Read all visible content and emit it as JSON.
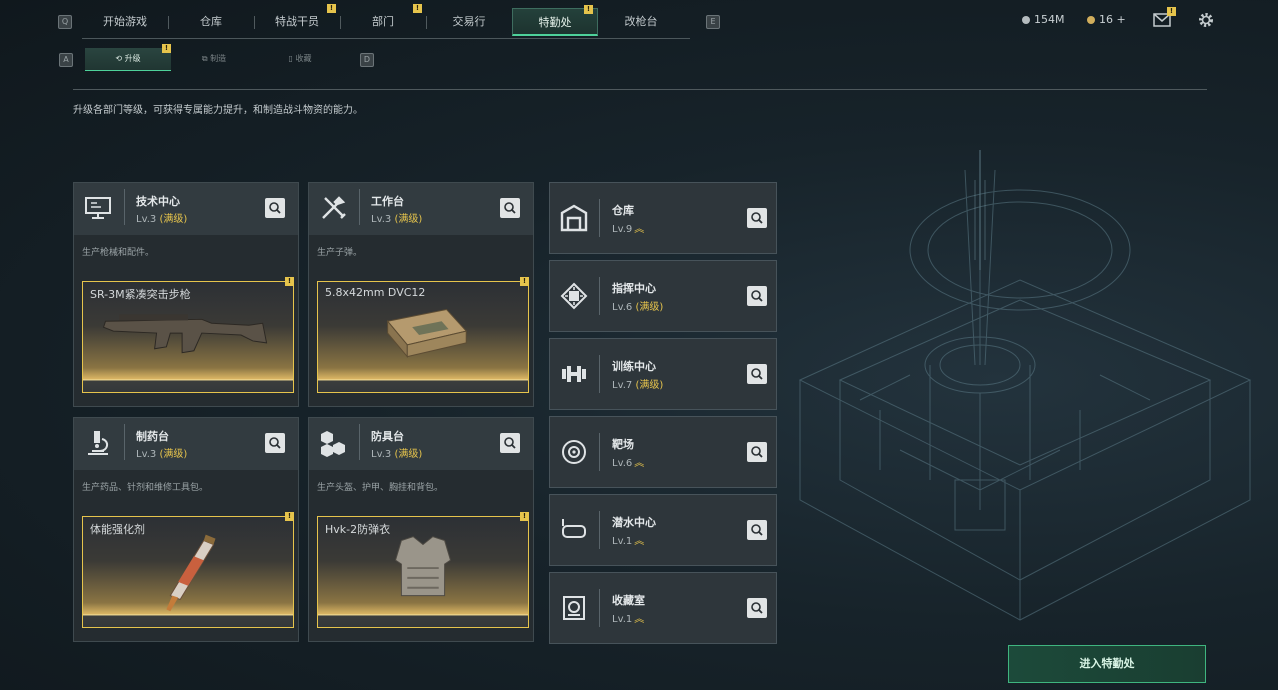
{
  "nav": {
    "left_key": "Q",
    "right_key": "E",
    "tabs": [
      {
        "label": "开始游戏",
        "badge": ""
      },
      {
        "label": "仓库",
        "badge": ""
      },
      {
        "label": "特战干员",
        "badge": "!"
      },
      {
        "label": "部门",
        "badge": "!"
      },
      {
        "label": "交易行",
        "badge": ""
      },
      {
        "label": "特勤处",
        "badge": "!",
        "active": true
      },
      {
        "label": "改枪台",
        "badge": ""
      }
    ]
  },
  "resources": {
    "currency": "154M",
    "coins": "16 +",
    "mail_badge": "!"
  },
  "subtabs": {
    "left_key": "A",
    "right_key": "D",
    "items": [
      {
        "label": "升级",
        "badge": "!",
        "active": true
      },
      {
        "label": "制造"
      },
      {
        "label": "收藏"
      }
    ]
  },
  "description": "升级各部门等级，可获得专属能力提升，和制造战斗物资的能力。",
  "cards": [
    {
      "name": "技术中心",
      "level": "Lv.3",
      "max": "(满级)",
      "text": "生产枪械和配件。",
      "item": "SR-3M紧凑突击步枪",
      "icon": "computer-icon",
      "badge": "!"
    },
    {
      "name": "工作台",
      "level": "Lv.3",
      "max": "(满级)",
      "text": "生产子弹。",
      "item": "5.8x42mm DVC12",
      "icon": "tools-icon",
      "badge": "!"
    },
    {
      "name": "制药台",
      "level": "Lv.3",
      "max": "(满级)",
      "text": "生产药品、针剂和维修工具包。",
      "item": "体能强化剂",
      "icon": "microscope-icon",
      "badge": "!"
    },
    {
      "name": "防具台",
      "level": "Lv.3",
      "max": "(满级)",
      "text": "生产头盔、护甲、胸挂和背包。",
      "item": "Hvk-2防弹衣",
      "icon": "cubes-icon",
      "badge": "!"
    }
  ],
  "departments": [
    {
      "name": "仓库",
      "level": "Lv.9",
      "max": "",
      "upgradable": true,
      "icon": "warehouse-icon"
    },
    {
      "name": "指挥中心",
      "level": "Lv.6",
      "max": "(满级)",
      "upgradable": false,
      "icon": "chip-icon"
    },
    {
      "name": "训练中心",
      "level": "Lv.7",
      "max": "(满级)",
      "upgradable": false,
      "icon": "dumbbell-icon"
    },
    {
      "name": "靶场",
      "level": "Lv.6",
      "max": "",
      "upgradable": true,
      "icon": "target-icon"
    },
    {
      "name": "潜水中心",
      "level": "Lv.1",
      "max": "",
      "upgradable": true,
      "icon": "goggles-icon"
    },
    {
      "name": "收藏室",
      "level": "Lv.1",
      "max": "",
      "upgradable": true,
      "icon": "collection-icon"
    }
  ],
  "enter_button": "进入特勤处",
  "colors": {
    "accent": "#4ed19a",
    "badge": "#e6c44c",
    "max_level": "#e6c44c"
  }
}
